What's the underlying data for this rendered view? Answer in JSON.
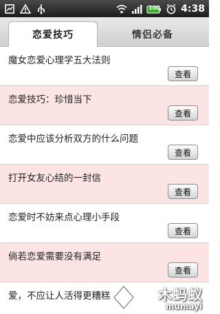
{
  "status_bar": {
    "time": "4:38",
    "battery_label": "100",
    "left_icons": [
      "sd-card-icon",
      "warning-icon",
      "usb-icon"
    ],
    "right_icons": [
      "wifi-icon",
      "signal-icon",
      "battery-icon",
      "alarm-icon"
    ]
  },
  "tabs": [
    {
      "label": "恋爱技巧",
      "active": true
    },
    {
      "label": "情侣必备",
      "active": false
    }
  ],
  "items": [
    {
      "title": "魔女恋爱心理学五大法则",
      "button": "查看"
    },
    {
      "title": "恋爱技巧：珍惜当下",
      "button": "查看"
    },
    {
      "title": "恋爱中应该分析双方的什么问题",
      "button": "查看"
    },
    {
      "title": "打开女友心结的一封信",
      "button": "查看"
    },
    {
      "title": "恋爱时不妨来点心理小手段",
      "button": "查看"
    },
    {
      "title": "倘若恋爱需要没有满足",
      "button": "查看"
    },
    {
      "title": "爱，不应让人活得更糟糕"
    }
  ],
  "watermark": {
    "text": "木蚂蚁",
    "url": "mumayi"
  },
  "colors": {
    "alt_row": "#fce4e4",
    "status_bar": "#1c1c1c",
    "tab_bar": "#dcdcdc"
  }
}
